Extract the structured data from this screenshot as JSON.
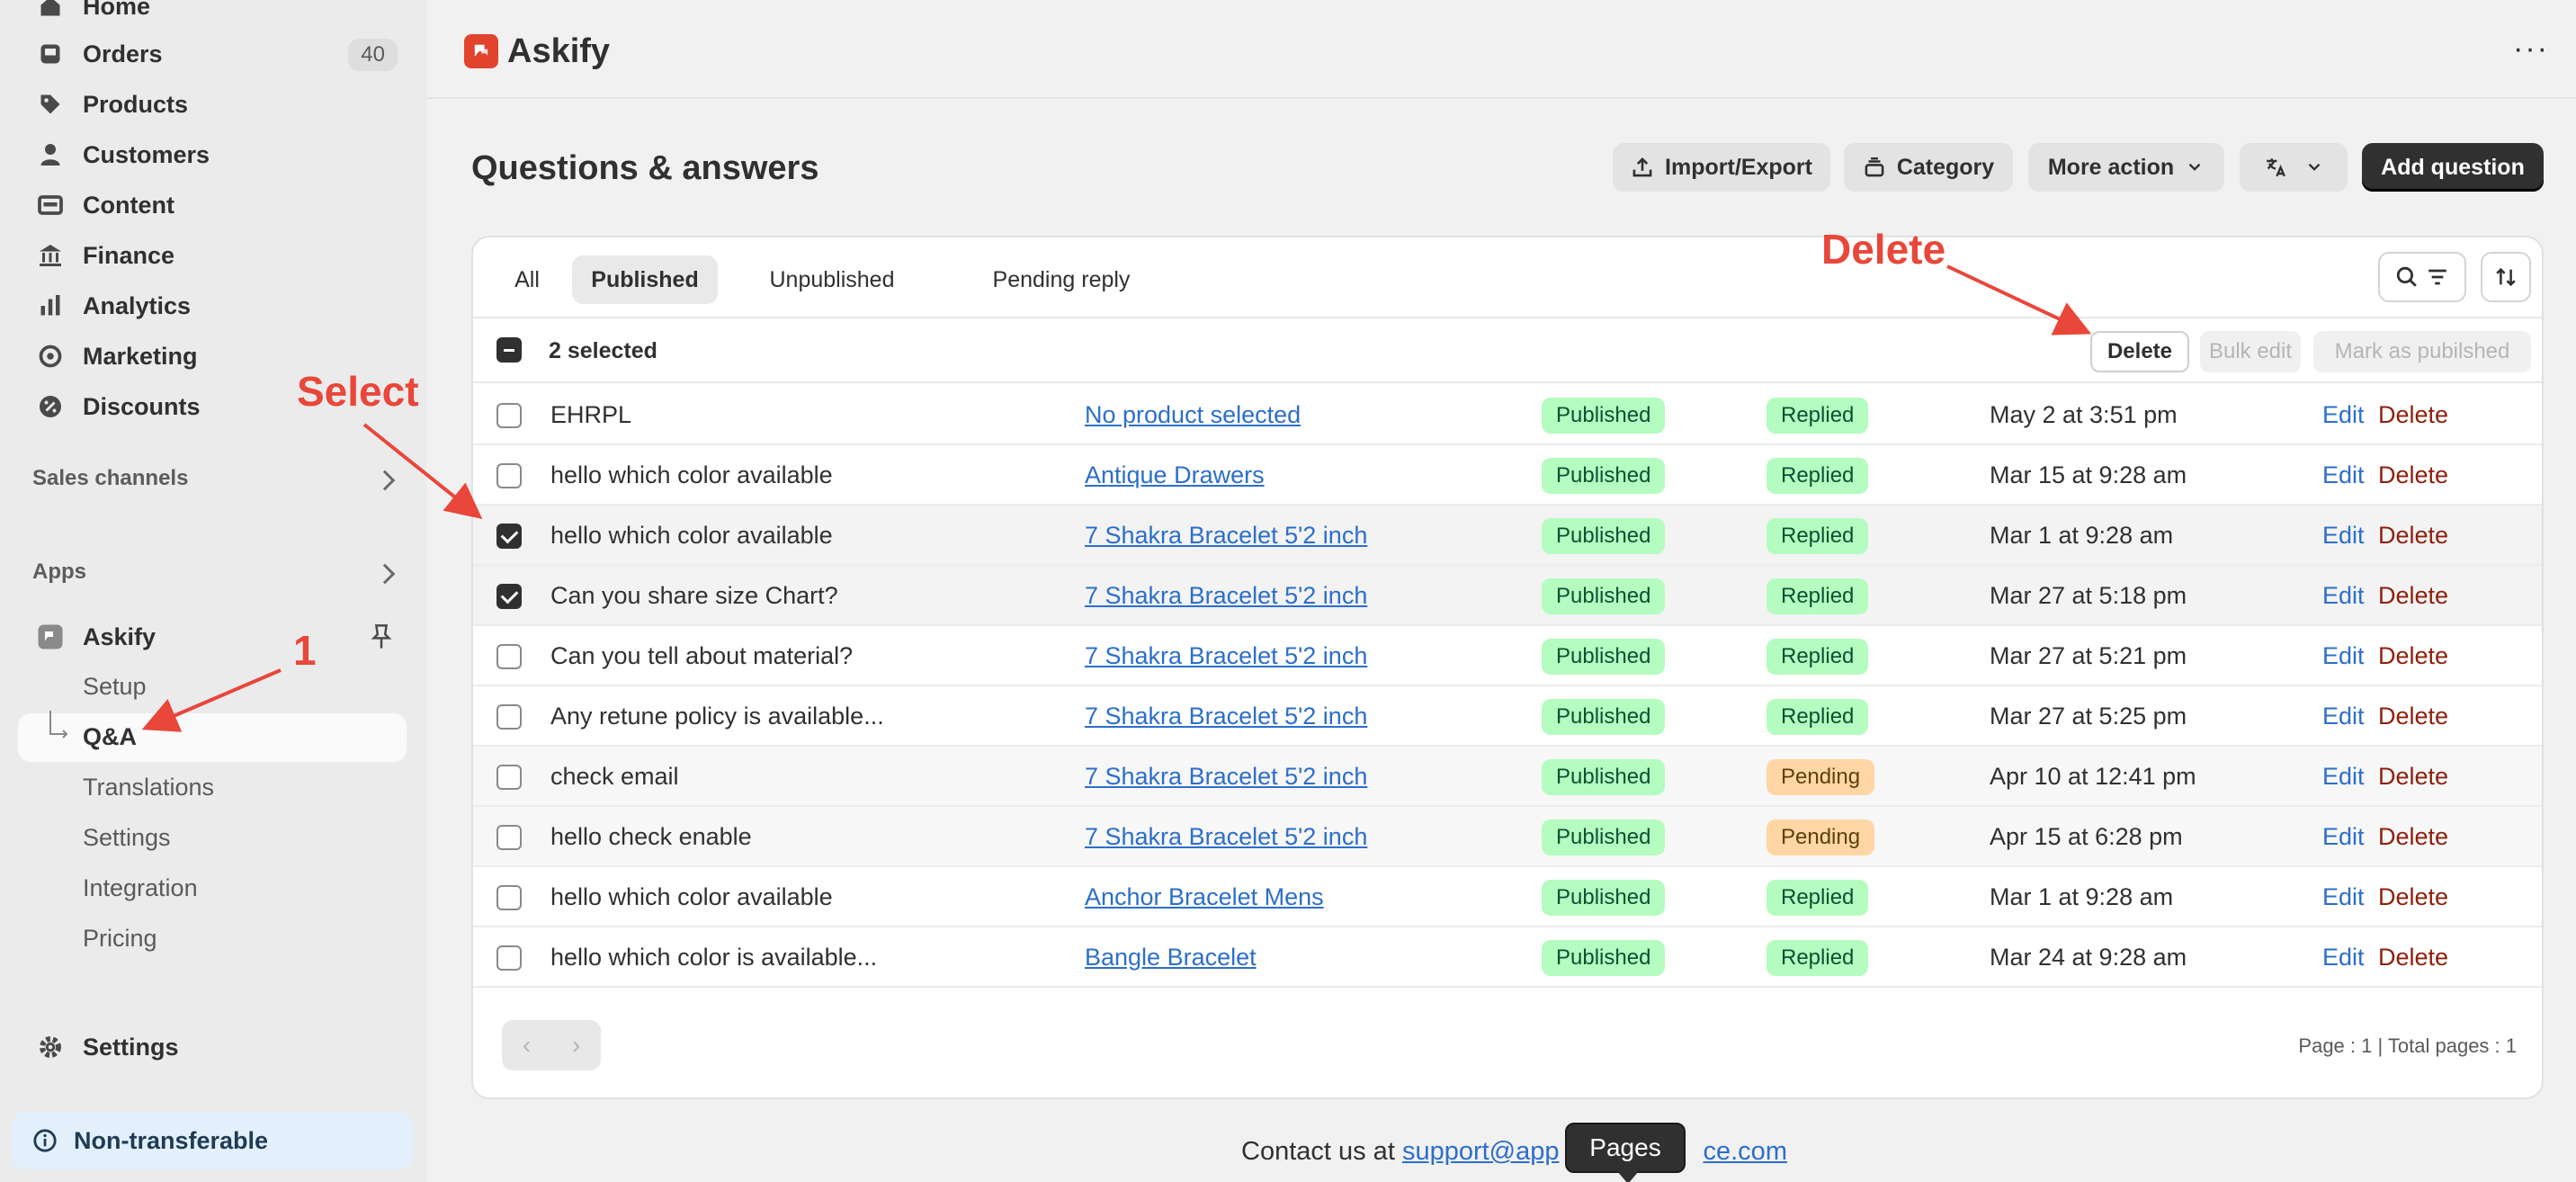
{
  "sidebar": {
    "items": [
      {
        "label": "Home",
        "icon": "home-icon"
      },
      {
        "label": "Orders",
        "icon": "inbox-icon",
        "count": "40"
      },
      {
        "label": "Products",
        "icon": "tag-icon"
      },
      {
        "label": "Customers",
        "icon": "person-icon"
      },
      {
        "label": "Content",
        "icon": "image-icon"
      },
      {
        "label": "Finance",
        "icon": "bank-icon"
      },
      {
        "label": "Analytics",
        "icon": "bar-chart-icon"
      },
      {
        "label": "Marketing",
        "icon": "target-icon"
      },
      {
        "label": "Discounts",
        "icon": "discount-icon"
      }
    ],
    "sales_channels": "Sales channels",
    "apps": "Apps",
    "app_name": "Askify",
    "app_sub_items": [
      "Setup",
      "Q&A",
      "Translations",
      "Settings",
      "Integration",
      "Pricing"
    ],
    "settings": "Settings",
    "non_transferable": "Non-transferable"
  },
  "header": {
    "app_title": "Askify"
  },
  "page": {
    "title": "Questions & answers",
    "buttons": {
      "import_export": "Import/Export",
      "category": "Category",
      "more_action": "More action",
      "add_question": "Add question"
    }
  },
  "tabs": [
    "All",
    "Published",
    "Unpublished",
    "Pending reply"
  ],
  "bulk": {
    "selected_text": "2 selected",
    "delete": "Delete",
    "bulk_edit": "Bulk edit",
    "mark_published": "Mark as pubilshed"
  },
  "rows": [
    {
      "question": "EHRPL",
      "product": "No product selected",
      "status": "Published",
      "reply": "Replied",
      "date": "May 2 at 3:51 pm",
      "checked": false
    },
    {
      "question": "hello which color available",
      "product": "Antique Drawers",
      "status": "Published",
      "reply": "Replied",
      "date": "Mar 15 at 9:28 am",
      "checked": false
    },
    {
      "question": "hello which color available",
      "product": "7 Shakra Bracelet 5'2 inch",
      "status": "Published",
      "reply": "Replied",
      "date": "Mar 1 at 9:28 am",
      "checked": true
    },
    {
      "question": "Can you share size Chart?",
      "product": "7 Shakra Bracelet 5'2 inch",
      "status": "Published",
      "reply": "Replied",
      "date": "Mar 27 at 5:18 pm",
      "checked": true
    },
    {
      "question": "Can you tell about material?",
      "product": "7 Shakra Bracelet 5'2 inch",
      "status": "Published",
      "reply": "Replied",
      "date": "Mar 27 at 5:21 pm",
      "checked": false
    },
    {
      "question": "Any retune policy is available...",
      "product": "7 Shakra Bracelet 5'2 inch",
      "status": "Published",
      "reply": "Replied",
      "date": "Mar 27 at 5:25 pm",
      "checked": false
    },
    {
      "question": "check email",
      "product": "7 Shakra Bracelet 5'2 inch",
      "status": "Published",
      "reply": "Pending",
      "date": "Apr 10 at 12:41 pm",
      "checked": false
    },
    {
      "question": "hello check enable",
      "product": "7 Shakra Bracelet 5'2 inch",
      "status": "Published",
      "reply": "Pending",
      "date": "Apr 15 at 6:28 pm",
      "checked": false
    },
    {
      "question": "hello which color available",
      "product": "Anchor Bracelet Mens",
      "status": "Published",
      "reply": "Replied",
      "date": "Mar 1 at 9:28 am",
      "checked": false
    },
    {
      "question": "hello which color is available...",
      "product": "Bangle Bracelet",
      "status": "Published",
      "reply": "Replied",
      "date": "Mar 24 at 9:28 am",
      "checked": false
    }
  ],
  "row_actions": {
    "edit": "Edit",
    "delete": "Delete"
  },
  "pagination": {
    "info": "Page : 1 | Total pages : 1",
    "prev": "‹",
    "next": "›"
  },
  "footer": {
    "prefix": "Contact us at ",
    "email_start": "support@app",
    "email_end": "ce.com"
  },
  "tooltip": "Pages",
  "annotations": {
    "select": "Select",
    "delete": "Delete",
    "step": "1"
  },
  "colors": {
    "accent": "#e8473a",
    "primary": "#303030",
    "link": "#2c6ecb"
  }
}
